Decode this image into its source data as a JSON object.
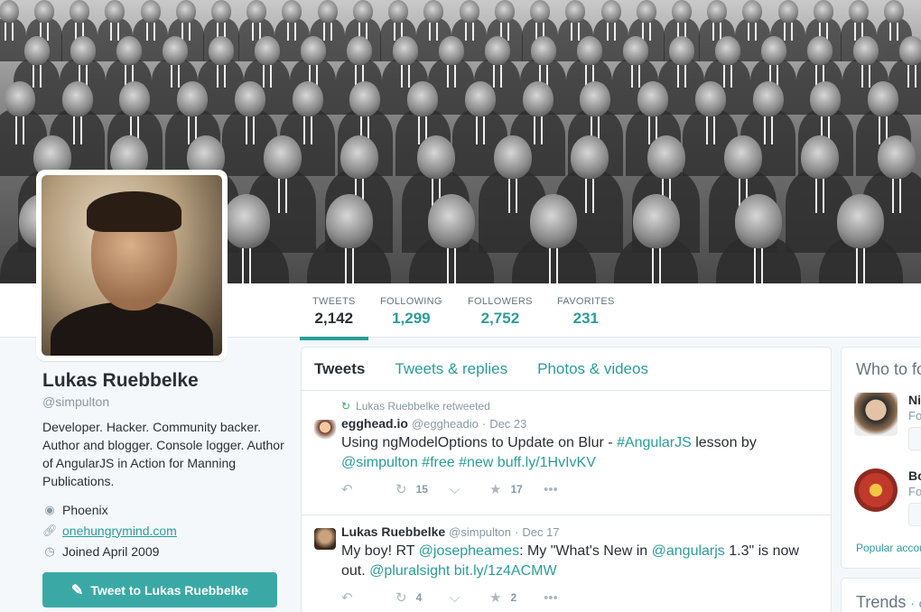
{
  "profile": {
    "name": "Lukas Ruebbelke",
    "handle": "@simpulton",
    "bio": "Developer. Hacker. Community backer. Author and blogger. Console logger. Author of AngularJS in Action for Manning Publications.",
    "location": "Phoenix",
    "website": "onehungrymind.com",
    "joined": "Joined April 2009",
    "tweet_to_label": "Tweet to Lukas Ruebbelke"
  },
  "nav": {
    "tweets": {
      "label": "TWEETS",
      "value": "2,142"
    },
    "following": {
      "label": "FOLLOWING",
      "value": "1,299"
    },
    "followers": {
      "label": "FOLLOWERS",
      "value": "2,752"
    },
    "favorites": {
      "label": "FAVORITES",
      "value": "231"
    }
  },
  "timeline": {
    "tabs": [
      "Tweets",
      "Tweets & replies",
      "Photos & videos"
    ],
    "tweets": [
      {
        "context": "Lukas Ruebbelke retweeted",
        "fullname": "egghead.io",
        "handle": "@eggheadio",
        "sep": "·",
        "date": "Dec 23",
        "text_a": "Using ngModelOptions to Update on Blur - ",
        "hashtag1": "#AngularJS",
        "text_b": " lesson by",
        "mention": "@simpulton",
        "hashtag2": "#free",
        "hashtag3": "#new",
        "link": "buff.ly/1HvIvKV",
        "retweets": "15",
        "favorites": "17"
      },
      {
        "fullname": "Lukas Ruebbelke",
        "handle": "@simpulton",
        "sep": "·",
        "date": "Dec 17",
        "text_a": "My boy! RT ",
        "mention1": "@josepheames",
        "text_b": ": My \"What's New in ",
        "mention2": "@angularjs",
        "text_c": " 1.3\" is now out. ",
        "mention3": "@pluralsight",
        "link": "bit.ly/1z4ACMW",
        "retweets": "4",
        "favorites": "2"
      }
    ]
  },
  "sidebar": {
    "who_title": "Who to fo",
    "users": [
      {
        "name": "Nic",
        "sub": "Fo"
      },
      {
        "name": "Bo",
        "sub": "Fo"
      }
    ],
    "popular": "Popular accou",
    "trends_title": "Trends",
    "trends_sep": "·",
    "trends_change": "c"
  },
  "icons": {
    "reply": "reply-icon",
    "retweet": "retweet-icon",
    "pocket": "pocket-icon",
    "favorite": "star-icon",
    "more": "more-icon"
  },
  "colors": {
    "accent": "#2a9d9a",
    "button": "#3aa9a6",
    "retweet_green": "#3aaa6a"
  }
}
